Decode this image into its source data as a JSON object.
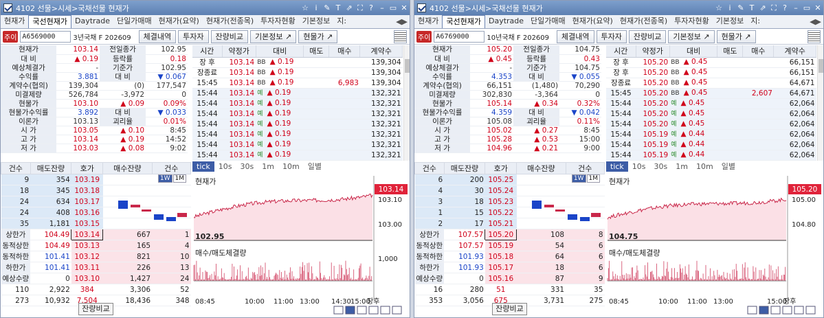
{
  "windows": [
    {
      "title": "4102 선물>시세>국채선물 현재가",
      "tabs": [
        "현재가",
        "국선현재가",
        "Daytrade",
        "단일가매매",
        "현재가(요약)",
        "현재가(전종목)",
        "투자자현황",
        "기본정보",
        "지:"
      ],
      "active_tab": 1,
      "code_badge": "주이",
      "code": "A6569000",
      "code_name": "3년국채 F 202609",
      "buttons": [
        "체결내역",
        "투자자",
        "잔량비교",
        "기본정보 ↗",
        "현물가 ↗"
      ],
      "quote": [
        {
          "l1": "현재가",
          "v1": "103.14",
          "c1": "r",
          "l2": "전일종가",
          "v2": "102.95",
          "c2": "dk"
        },
        {
          "l1": "대  비",
          "v1": "▲ 0.19",
          "c1": "r",
          "l2": "등락률",
          "v2": "0.18",
          "c2": "r"
        },
        {
          "l1": "예상체결가",
          "v1": "-",
          "c1": "dk",
          "l2": "기준가",
          "v2": "102.95",
          "c2": "dk"
        },
        {
          "l1": "수익률",
          "v1": "3.881",
          "c1": "b",
          "l2": "대  비",
          "v2": "▼ 0.067",
          "c2": "b"
        },
        {
          "l1": "계약수(협의)",
          "v1": "139,304",
          "c1": "dk",
          "m": "(0)",
          "v2": "177,547",
          "c2": "dk"
        },
        {
          "l1": "미결제량",
          "v1": "526,784",
          "c1": "dk",
          "m": "-3,972",
          "v2": "0",
          "c2": "dk"
        },
        {
          "l1": "현물가",
          "v1": "103.10",
          "c1": "r",
          "m": "▲ 0.09",
          "v2": "0.09%",
          "c2": "r"
        },
        {
          "l1": "현물가수익률",
          "v1": "3.892",
          "c1": "b",
          "l2": "대  비",
          "v2": "▼ 0.033",
          "c2": "b"
        },
        {
          "l1": "이론가",
          "v1": "103.13",
          "c1": "dk",
          "l2": "괴리율",
          "v2": "0.01%",
          "c2": "r"
        },
        {
          "l1": "시  가",
          "v1": "103.05",
          "c1": "r",
          "m": "▲ 0.10",
          "v2": "8:45",
          "c2": "dk"
        },
        {
          "l1": "고  가",
          "v1": "103.14",
          "c1": "r",
          "m": "▲ 0.19",
          "v2": "14:52",
          "c2": "dk"
        },
        {
          "l1": "저  가",
          "v1": "103.03",
          "c1": "r",
          "m": "▲ 0.08",
          "v2": "9:02",
          "c2": "dk"
        }
      ],
      "ticks_headers": [
        "시간",
        "약정가",
        "대비",
        "매도",
        "매수",
        "계약수"
      ],
      "ticks": [
        {
          "t": "장 후",
          "p": "103.14",
          "bb": "BB",
          "d": "▲ 0.19",
          "s": "",
          "bq": "",
          "q": "139,304"
        },
        {
          "t": "장종료",
          "p": "103.14",
          "bb": "BB",
          "d": "▲ 0.19",
          "s": "",
          "bq": "",
          "q": "139,304"
        },
        {
          "t": "15:45",
          "p": "103.14",
          "bb": "BB",
          "d": "▲ 0.19",
          "s": "",
          "bq": "6,983",
          "q": "139,304"
        },
        {
          "t": "15:44",
          "p": "103.14",
          "bb": "예",
          "d": "▲ 0.19",
          "s": "",
          "bq": "",
          "q": "132,321"
        },
        {
          "t": "15:44",
          "p": "103.14",
          "bb": "예",
          "d": "▲ 0.19",
          "s": "",
          "bq": "",
          "q": "132,321"
        },
        {
          "t": "15:44",
          "p": "103.14",
          "bb": "예",
          "d": "▲ 0.19",
          "s": "",
          "bq": "",
          "q": "132,321"
        },
        {
          "t": "15:44",
          "p": "103.14",
          "bb": "예",
          "d": "▲ 0.19",
          "s": "",
          "bq": "",
          "q": "132,321"
        },
        {
          "t": "15:44",
          "p": "103.14",
          "bb": "예",
          "d": "▲ 0.19",
          "s": "",
          "bq": "",
          "q": "132,321"
        },
        {
          "t": "15:44",
          "p": "103.14",
          "bb": "예",
          "d": "▲ 0.19",
          "s": "",
          "bq": "",
          "q": "132,321"
        },
        {
          "t": "15:44",
          "p": "103.14",
          "bb": "예",
          "d": "▲ 0.19",
          "s": "",
          "bq": "",
          "q": "132,321"
        }
      ],
      "ob_headers": [
        "건수",
        "매도잔량",
        "호가",
        "매수잔량",
        "건수"
      ],
      "asks": [
        [
          "9",
          "354",
          "103.19"
        ],
        [
          "18",
          "345",
          "103.18"
        ],
        [
          "24",
          "634",
          "103.17"
        ],
        [
          "24",
          "408",
          "103.16"
        ],
        [
          "35",
          "1,181",
          "103.15"
        ]
      ],
      "bids": [
        {
          "lab": "상한가",
          "lv": "104.49",
          "px": "103.14",
          "q": "667",
          "n": "1",
          "cur": true
        },
        {
          "lab": "동적상한",
          "lv": "104.49",
          "px": "103.13",
          "q": "165",
          "n": "4"
        },
        {
          "lab": "동적하한",
          "lv": "101.41",
          "px": "103.12",
          "q": "821",
          "n": "10"
        },
        {
          "lab": "하한가",
          "lv": "101.41",
          "px": "103.11",
          "q": "226",
          "n": "13"
        },
        {
          "lab": "예상수량",
          "lv": "0",
          "px": "103.10",
          "q": "1,427",
          "n": "24"
        }
      ],
      "tot1": [
        "110",
        "2,922",
        "384",
        "3,306",
        "52"
      ],
      "tot2": [
        "273",
        "10,932",
        "7,504",
        "18,436",
        "348"
      ],
      "ob_footer": "잔량비교",
      "mini_tabs": [
        "1W",
        "1M"
      ],
      "range_tabs": [
        "tick",
        "10s",
        "30s",
        "1m",
        "10m",
        "일별"
      ],
      "chart_title": "현재가",
      "vol_title": "매수/매도체결량",
      "last_label": "103.14",
      "low_label": "102.95",
      "y_ticks": [
        "103.10",
        "103.00"
      ],
      "vol_tick": "1,000",
      "x_ticks": [
        "08:45",
        "10:00",
        "11:00",
        "13:00",
        "14:30",
        "15:00",
        "장후"
      ],
      "chart_data": {
        "type": "area",
        "title": "현재가",
        "ylim": [
          102.95,
          103.16
        ],
        "start": 103.04,
        "end": 103.14
      }
    },
    {
      "title": "4102 선물>시세>국채선물 현재가",
      "tabs": [
        "현재가",
        "국선현재가",
        "Daytrade",
        "단일가매매",
        "현재가(요약)",
        "현재가(전종목)",
        "투자자현황",
        "기본정보",
        "지:"
      ],
      "active_tab": 1,
      "code_badge": "주이",
      "code": "A6769000",
      "code_name": "10년국채 F 202609",
      "buttons": [
        "체결내역",
        "투자자",
        "잔량비교",
        "기본정보 ↗",
        "현물가 ↗"
      ],
      "quote": [
        {
          "l1": "현재가",
          "v1": "105.20",
          "c1": "r",
          "l2": "전일종가",
          "v2": "104.75",
          "c2": "dk"
        },
        {
          "l1": "대  비",
          "v1": "▲ 0.45",
          "c1": "r",
          "l2": "등락률",
          "v2": "0.43",
          "c2": "r"
        },
        {
          "l1": "예상체결가",
          "v1": "-",
          "c1": "dk",
          "l2": "기준가",
          "v2": "104.75",
          "c2": "dk"
        },
        {
          "l1": "수익률",
          "v1": "4.353",
          "c1": "b",
          "l2": "대  비",
          "v2": "▼ 0.055",
          "c2": "b"
        },
        {
          "l1": "계약수(협의)",
          "v1": "66,151",
          "c1": "dk",
          "m": "(1,480)",
          "v2": "70,290",
          "c2": "dk"
        },
        {
          "l1": "미결제량",
          "v1": "302,830",
          "c1": "dk",
          "m": "-3,364",
          "v2": "0",
          "c2": "dk"
        },
        {
          "l1": "현물가",
          "v1": "105.14",
          "c1": "r",
          "m": "▲ 0.34",
          "v2": "0.32%",
          "c2": "r"
        },
        {
          "l1": "현물가수익률",
          "v1": "4.359",
          "c1": "b",
          "l2": "대  비",
          "v2": "▼ 0.042",
          "c2": "b"
        },
        {
          "l1": "이론가",
          "v1": "105.08",
          "c1": "dk",
          "l2": "괴리율",
          "v2": "0.11%",
          "c2": "r"
        },
        {
          "l1": "시  가",
          "v1": "105.02",
          "c1": "r",
          "m": "▲ 0.27",
          "v2": "8:45",
          "c2": "dk"
        },
        {
          "l1": "고  가",
          "v1": "105.28",
          "c1": "r",
          "m": "▲ 0.53",
          "v2": "15:00",
          "c2": "dk"
        },
        {
          "l1": "저  가",
          "v1": "104.96",
          "c1": "r",
          "m": "▲ 0.21",
          "v2": "9:00",
          "c2": "dk"
        }
      ],
      "ticks_headers": [
        "시간",
        "약정가",
        "대비",
        "매도",
        "매수",
        "계약수"
      ],
      "ticks": [
        {
          "t": "장 후",
          "p": "105.20",
          "bb": "BB",
          "d": "▲ 0.45",
          "s": "",
          "bq": "",
          "q": "66,151"
        },
        {
          "t": "장 후",
          "p": "105.20",
          "bb": "BB",
          "d": "▲ 0.45",
          "s": "",
          "bq": "",
          "q": "66,151"
        },
        {
          "t": "장종료",
          "p": "105.20",
          "bb": "BB",
          "d": "▲ 0.45",
          "s": "",
          "bq": "",
          "q": "64,671"
        },
        {
          "t": "15:45",
          "p": "105.20",
          "bb": "BB",
          "d": "▲ 0.45",
          "s": "",
          "bq": "2,607",
          "q": "64,671"
        },
        {
          "t": "15:44",
          "p": "105.20",
          "bb": "예",
          "d": "▲ 0.45",
          "s": "",
          "bq": "",
          "q": "62,064"
        },
        {
          "t": "15:44",
          "p": "105.20",
          "bb": "예",
          "d": "▲ 0.45",
          "s": "",
          "bq": "",
          "q": "62,064"
        },
        {
          "t": "15:44",
          "p": "105.20",
          "bb": "예",
          "d": "▲ 0.45",
          "s": "",
          "bq": "",
          "q": "62,064"
        },
        {
          "t": "15:44",
          "p": "105.19",
          "bb": "예",
          "d": "▲ 0.44",
          "s": "",
          "bq": "",
          "q": "62,064"
        },
        {
          "t": "15:44",
          "p": "105.19",
          "bb": "예",
          "d": "▲ 0.44",
          "s": "",
          "bq": "",
          "q": "62,064"
        },
        {
          "t": "15:44",
          "p": "105.19",
          "bb": "예",
          "d": "▲ 0.44",
          "s": "",
          "bq": "",
          "q": "62,064"
        }
      ],
      "ob_headers": [
        "건수",
        "매도잔량",
        "호가",
        "매수잔량",
        "건수"
      ],
      "asks": [
        [
          "6",
          "200",
          "105.25"
        ],
        [
          "4",
          "30",
          "105.24"
        ],
        [
          "3",
          "18",
          "105.23"
        ],
        [
          "1",
          "15",
          "105.22"
        ],
        [
          "2",
          "17",
          "105.21"
        ]
      ],
      "bids": [
        {
          "lab": "상한가",
          "lv": "107.57",
          "px": "105.20",
          "q": "108",
          "n": "8",
          "cur": true
        },
        {
          "lab": "동적상한",
          "lv": "107.57",
          "px": "105.19",
          "q": "54",
          "n": "6"
        },
        {
          "lab": "동적하한",
          "lv": "101.93",
          "px": "105.18",
          "q": "64",
          "n": "6"
        },
        {
          "lab": "하한가",
          "lv": "101.93",
          "px": "105.17",
          "q": "18",
          "n": "6"
        },
        {
          "lab": "예상수량",
          "lv": "0",
          "px": "105.16",
          "q": "87",
          "n": "9"
        }
      ],
      "tot1": [
        "16",
        "280",
        "51",
        "331",
        "35"
      ],
      "tot2": [
        "353",
        "3,056",
        "675",
        "3,731",
        "275"
      ],
      "ob_footer": "잔량비교",
      "mini_tabs": [
        "1W",
        "1M"
      ],
      "range_tabs": [
        "tick",
        "10s",
        "30s",
        "1m",
        "10m",
        "일별"
      ],
      "chart_title": "현재가",
      "vol_title": "매수/매도체결량",
      "last_label": "105.20",
      "low_label": "104.75",
      "y_ticks": [
        "105.00",
        "104.80"
      ],
      "vol_tick": "",
      "x_ticks": [
        "08:45",
        "10:00",
        "11:00",
        "13:00",
        "15:00",
        "장후"
      ],
      "chart_data": {
        "type": "area",
        "title": "현재가",
        "ylim": [
          104.75,
          105.3
        ],
        "start": 104.98,
        "end": 105.2
      }
    }
  ],
  "colors": {
    "up": "#d0021b",
    "down": "#1a44c8",
    "chart_fill": "#fbe0e6",
    "chart_line": "#c9284a"
  }
}
